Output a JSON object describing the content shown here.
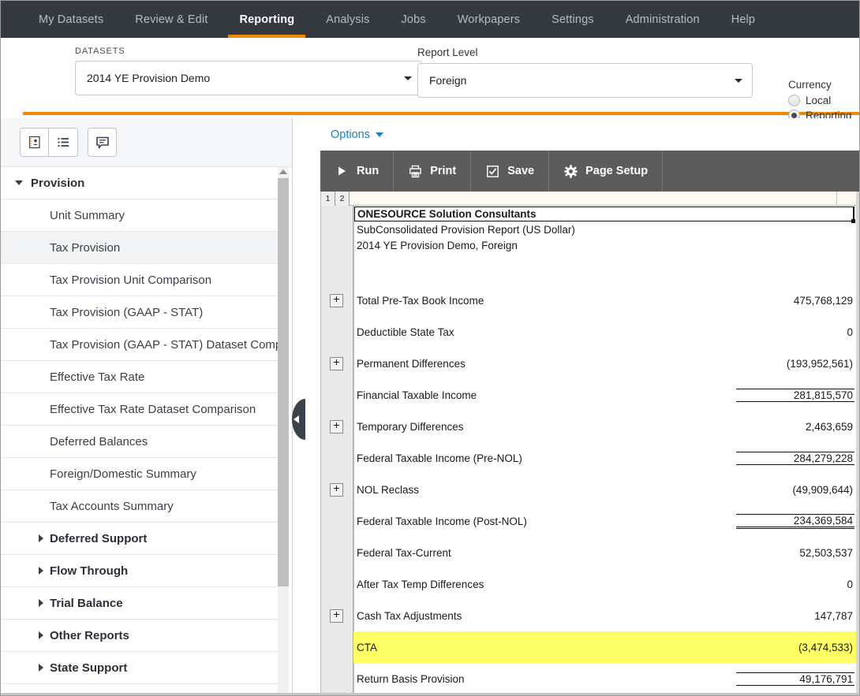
{
  "topnav": {
    "items": [
      {
        "label": "My Datasets",
        "active": false
      },
      {
        "label": "Review & Edit",
        "active": false
      },
      {
        "label": "Reporting",
        "active": true
      },
      {
        "label": "Analysis",
        "active": false
      },
      {
        "label": "Jobs",
        "active": false
      },
      {
        "label": "Workpapers",
        "active": false
      },
      {
        "label": "Settings",
        "active": false
      },
      {
        "label": "Administration",
        "active": false
      },
      {
        "label": "Help",
        "active": false
      }
    ]
  },
  "filterbar": {
    "datasets_label": "DATASETS",
    "datasets_value": "2014 YE Provision Demo",
    "report_level_label": "Report Level",
    "report_level_value": "Foreign",
    "currency_label": "Currency",
    "currency_options": [
      {
        "label": "Local",
        "selected": false
      },
      {
        "label": "Reporting",
        "selected": true
      }
    ]
  },
  "sidebar": {
    "toolbar_buttons": [
      {
        "icon": "contact-card-icon"
      },
      {
        "icon": "list-view-icon"
      },
      {
        "icon": "comment-icon"
      }
    ],
    "tree": [
      {
        "label": "Provision",
        "type": "group",
        "expanded": true,
        "selected": false
      },
      {
        "label": "Unit Summary",
        "type": "child",
        "selected": false
      },
      {
        "label": "Tax Provision",
        "type": "child",
        "selected": true
      },
      {
        "label": "Tax Provision Unit Comparison",
        "type": "child",
        "selected": false
      },
      {
        "label": "Tax Provision (GAAP - STAT)",
        "type": "child",
        "selected": false
      },
      {
        "label": "Tax Provision (GAAP - STAT) Dataset Comparison",
        "type": "child",
        "selected": false
      },
      {
        "label": "Effective Tax Rate",
        "type": "child",
        "selected": false
      },
      {
        "label": "Effective Tax Rate Dataset Comparison",
        "type": "child",
        "selected": false
      },
      {
        "label": "Deferred Balances",
        "type": "child",
        "selected": false
      },
      {
        "label": "Foreign/Domestic Summary",
        "type": "child",
        "selected": false
      },
      {
        "label": "Tax Accounts Summary",
        "type": "child",
        "selected": false
      },
      {
        "label": "Deferred Support",
        "type": "group",
        "expanded": false,
        "selected": false
      },
      {
        "label": "Flow Through",
        "type": "group",
        "expanded": false,
        "selected": false
      },
      {
        "label": "Trial Balance",
        "type": "group",
        "expanded": false,
        "selected": false
      },
      {
        "label": "Other Reports",
        "type": "group",
        "expanded": false,
        "selected": false
      },
      {
        "label": "State Support",
        "type": "group",
        "expanded": false,
        "selected": false
      }
    ]
  },
  "main": {
    "options_label": "Options",
    "toolbar": [
      {
        "label": "Run",
        "icon": "play-icon"
      },
      {
        "label": "Print",
        "icon": "printer-icon"
      },
      {
        "label": "Save",
        "icon": "checkbox-icon"
      },
      {
        "label": "Page Setup",
        "icon": "gear-icon"
      }
    ],
    "outline_levels": [
      "1",
      "2"
    ],
    "report_header": {
      "company": "ONESOURCE Solution Consultants",
      "report_title": "SubConsolidated Provision Report (US Dollar)",
      "dataset_line": "2014 YE Provision Demo, Foreign"
    },
    "rows": [
      {
        "label": "Total Pre-Tax Book Income",
        "value": "475,768,129",
        "expandable": true,
        "underline": "none",
        "highlight": false
      },
      {
        "label": "Deductible State Tax",
        "value": "0",
        "expandable": false,
        "underline": "none",
        "highlight": false
      },
      {
        "label": "Permanent Differences",
        "value": "(193,952,561)",
        "expandable": true,
        "underline": "none",
        "highlight": false
      },
      {
        "label": "Financial Taxable Income",
        "value": "281,815,570",
        "expandable": false,
        "underline": "single",
        "highlight": false
      },
      {
        "label": "Temporary Differences",
        "value": "2,463,659",
        "expandable": true,
        "underline": "none",
        "highlight": false
      },
      {
        "label": "Federal Taxable Income (Pre-NOL)",
        "value": "284,279,228",
        "expandable": false,
        "underline": "single",
        "highlight": false
      },
      {
        "label": "NOL Reclass",
        "value": "(49,909,644)",
        "expandable": true,
        "underline": "none",
        "highlight": false
      },
      {
        "label": "Federal Taxable Income (Post-NOL)",
        "value": "234,369,584",
        "expandable": false,
        "underline": "double",
        "highlight": false
      },
      {
        "label": "Federal Tax-Current",
        "value": "52,503,537",
        "expandable": false,
        "underline": "none",
        "highlight": false
      },
      {
        "label": "After Tax Temp Differences",
        "value": "0",
        "expandable": false,
        "underline": "none",
        "highlight": false
      },
      {
        "label": "Cash Tax Adjustments",
        "value": "147,787",
        "expandable": true,
        "underline": "none",
        "highlight": false
      },
      {
        "label": "CTA",
        "value": "(3,474,533)",
        "expandable": false,
        "underline": "none",
        "highlight": true
      },
      {
        "label": "Return Basis Provision",
        "value": "49,176,791",
        "expandable": false,
        "underline": "single",
        "highlight": false
      }
    ]
  },
  "colors": {
    "accent": "#f08a00",
    "navbar": "#343a40",
    "toolbar": "#5c5c5c",
    "link": "#1b7fc4",
    "highlight": "#ffff66"
  }
}
